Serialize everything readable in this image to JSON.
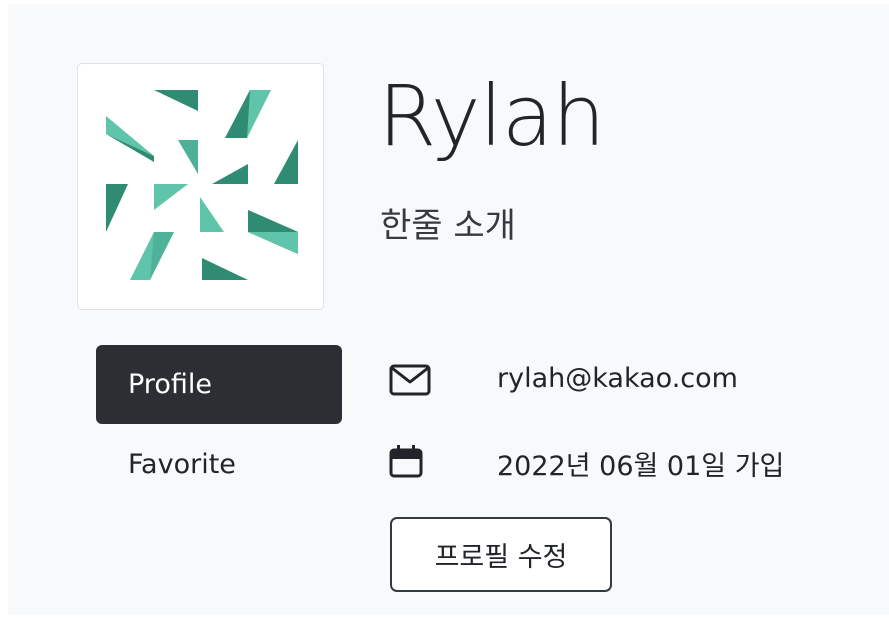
{
  "profile": {
    "username": "Rylah",
    "bio": "한줄 소개",
    "avatar_icon": "identicon-avatar",
    "avatar_colors": [
      "#5ec5ab",
      "#2f8c72"
    ]
  },
  "nav": {
    "items": [
      {
        "label": "Profile",
        "active": true
      },
      {
        "label": "Favorite",
        "active": false
      }
    ]
  },
  "info": {
    "email": {
      "icon": "envelope-icon",
      "value": "rylah@kakao.com"
    },
    "joined": {
      "icon": "calendar-icon",
      "value": "2022년 06월 01일 가입"
    }
  },
  "actions": {
    "edit_label": "프로필 수정"
  },
  "colors": {
    "accent_dark": "#2b2f33",
    "background": "#f8f9fa",
    "border": "#dee2e6"
  }
}
